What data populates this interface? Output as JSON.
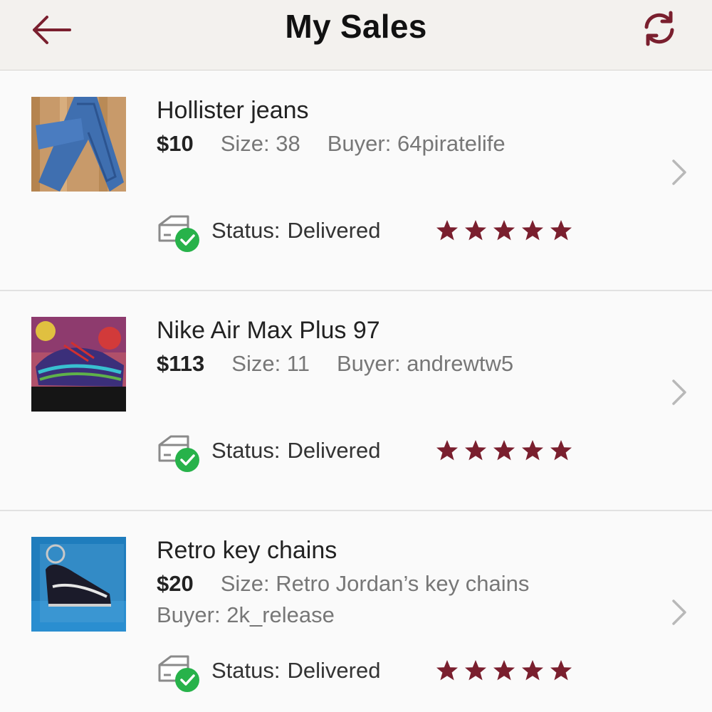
{
  "header": {
    "title": "My Sales"
  },
  "colors": {
    "accent": "#7a1f2e",
    "delivered_check": "#27b24a",
    "header_bg": "#f3f1ee"
  },
  "icons": {
    "back": "arrow-left-icon",
    "refresh": "refresh-icon",
    "status": "package-delivered-icon",
    "rating": "star-icon",
    "row_action": "chevron-right-icon"
  },
  "sales": [
    {
      "title": "Hollister jeans",
      "price": "$10",
      "size": "Size: 38",
      "buyer": "Buyer: 64piratelife",
      "status_label": "Status:",
      "status_value": "Delivered",
      "rating": 5
    },
    {
      "title": "Nike Air Max Plus 97",
      "price": "$113",
      "size": "Size: 11",
      "buyer": "Buyer: andrewtw5",
      "status_label": "Status:",
      "status_value": "Delivered",
      "rating": 5
    },
    {
      "title": "Retro key chains",
      "price": "$20",
      "size": "Size: Retro Jordan’s key chains",
      "buyer": "Buyer: 2k_release",
      "status_label": "Status:",
      "status_value": "Delivered",
      "rating": 5
    }
  ]
}
